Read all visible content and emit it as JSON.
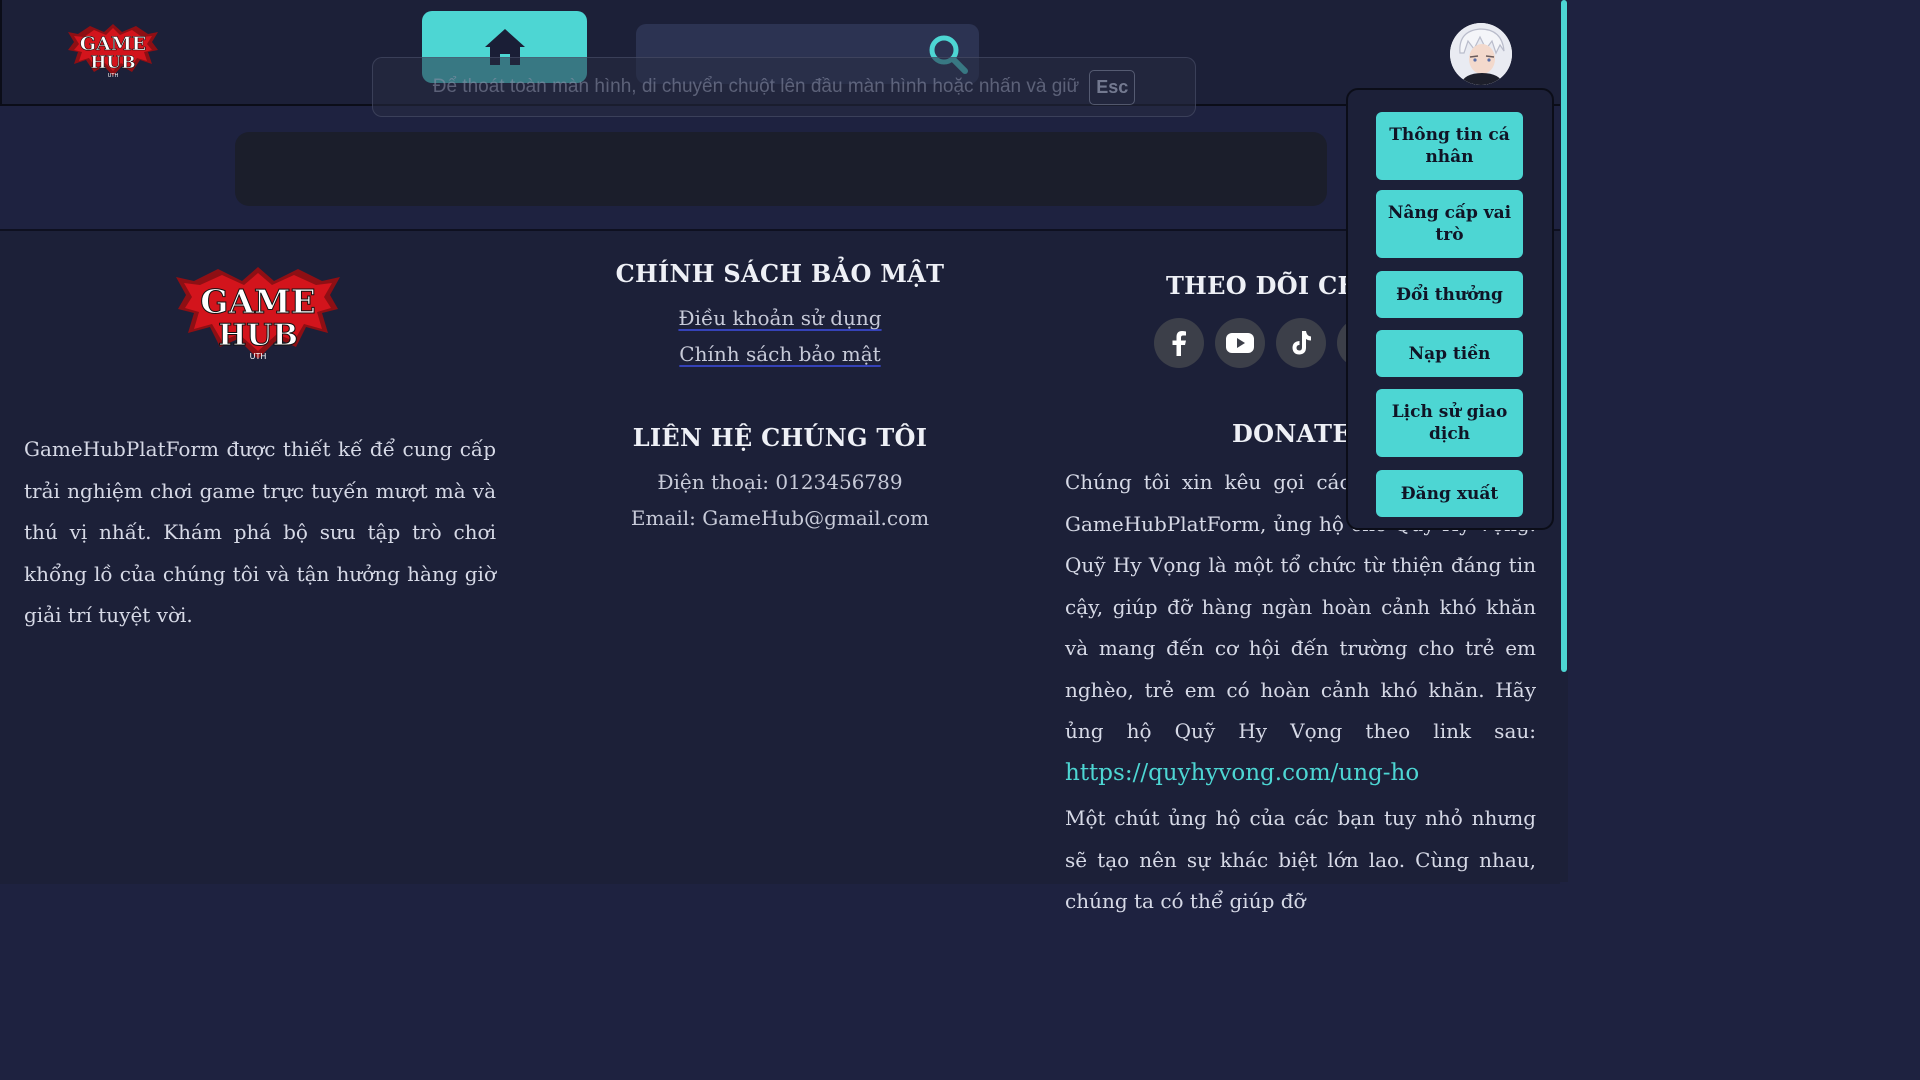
{
  "header": {
    "logo_line1": "GAME",
    "logo_line2": "HUB",
    "logo_sub": "UTH",
    "home_icon": "home-icon",
    "search_placeholder": "",
    "search_icon": "search-icon",
    "fullscreen_hint": "Để thoát toàn màn hình, di chuyển chuột lên đầu màn hình hoặc nhấn và giữ",
    "esc_key": "Esc",
    "avatar_icon": "user-avatar"
  },
  "dropdown": {
    "items": [
      {
        "label": "Thông tin cá nhân"
      },
      {
        "label": "Nâng cấp vai trò"
      },
      {
        "label": "Đổi thưởng"
      },
      {
        "label": "Nạp tiền"
      },
      {
        "label": "Lịch sử giao dịch"
      },
      {
        "label": "Đăng xuất"
      }
    ]
  },
  "footer": {
    "logo_line1": "GAME",
    "logo_line2": "HUB",
    "logo_sub": "UTH",
    "about": "GameHubPlatForm được thiết kế để cung cấp trải nghiệm chơi game trực tuyến mượt mà và thú vị nhất. Khám phá bộ sưu tập trò chơi khổng lồ của chúng tôi và tận hưởng hàng giờ giải trí tuyệt vời.",
    "policy_title": "CHÍNH SÁCH BẢO MẬT",
    "policy_links": [
      "Điều khoản sử dụng",
      "Chính sách bảo mật"
    ],
    "contact_title": "LIÊN HỆ CHÚNG TÔI",
    "phone": "Điện thoại: 0123456789",
    "email": "Email: GameHub@gmail.com",
    "follow_title": "THEO DÕI CHÚ",
    "social_icons": [
      "facebook-icon",
      "youtube-icon",
      "tiktok-icon"
    ],
    "donate_title": "DONATE",
    "donate_p1_a": "Chúng tôi xin kêu gọi các bạn,",
    "donate_p1_b": "donate cho GameHubPlatForm,",
    "donate_p1_c": "ủng hộ cho Quỹ Hy Vọng. Quỹ Hy Vọng là một tổ chức từ thiện đáng tin cậy, giúp đỡ hàng ngàn hoàn cảnh khó khăn và mang đến cơ hội đến trường cho trẻ em nghèo, trẻ em có hoàn cảnh khó khăn. Hãy ủng hộ Quỹ Hy Vọng theo link sau:",
    "donate_link": "https://quyhyvong.com/ung-ho",
    "donate_p2": "Một chút ủng hộ của các bạn tuy nhỏ nhưng sẽ tạo nên sự khác biệt lớn lao. Cùng nhau, chúng ta có thể giúp đỡ"
  },
  "colors": {
    "accent": "#4dd6d3",
    "page_bg": "#1e2240",
    "panel_bg": "#1c2038",
    "logo_red": "#d3141c"
  }
}
